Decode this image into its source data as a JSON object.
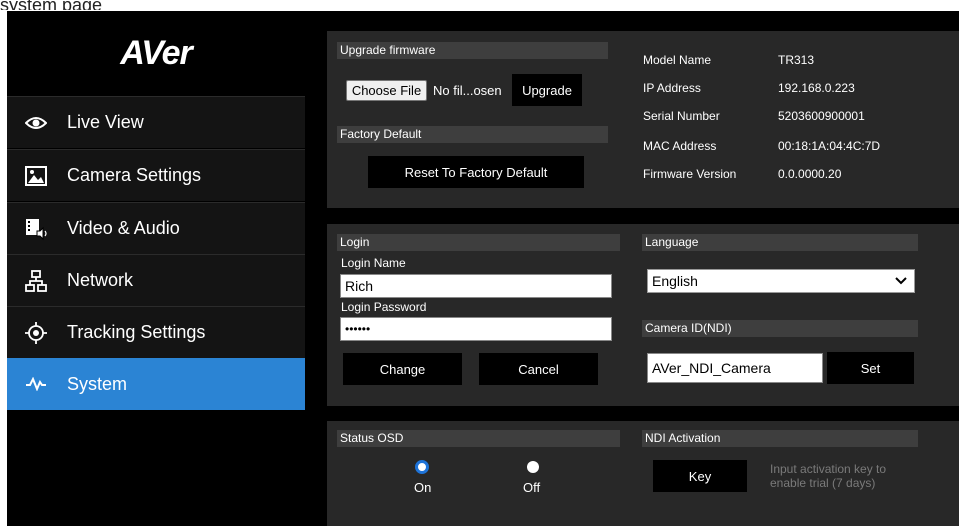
{
  "page_caption": "system page",
  "logo_text": "AVer",
  "sidebar": {
    "items": [
      {
        "label": "Live View",
        "icon": "eye-icon"
      },
      {
        "label": "Camera Settings",
        "icon": "image-icon"
      },
      {
        "label": "Video & Audio",
        "icon": "video-audio-icon"
      },
      {
        "label": "Network",
        "icon": "network-icon"
      },
      {
        "label": "Tracking Settings",
        "icon": "crosshair-icon"
      },
      {
        "label": "System",
        "icon": "pulse-icon",
        "active": true
      }
    ]
  },
  "upgrade": {
    "header": "Upgrade firmware",
    "choose_file_label": "Choose File",
    "file_status": "No fil...osen",
    "upgrade_label": "Upgrade"
  },
  "factory": {
    "header": "Factory Default",
    "reset_label": "Reset To Factory Default"
  },
  "device_info": {
    "model_name_label": "Model Name",
    "model_name": "TR313",
    "ip_label": "IP Address",
    "ip": "192.168.0.223",
    "serial_label": "Serial Number",
    "serial": "5203600900001",
    "mac_label": "MAC Address",
    "mac": "00:18:1A:04:4C:7D",
    "firmware_label": "Firmware Version",
    "firmware": "0.0.0000.20"
  },
  "login": {
    "header": "Login",
    "name_label": "Login Name",
    "name_value": "Rich",
    "password_label": "Login Password",
    "password_value": "••••••",
    "change_label": "Change",
    "cancel_label": "Cancel"
  },
  "language": {
    "header": "Language",
    "selected": "English"
  },
  "camera_id": {
    "header": "Camera ID(NDI)",
    "value": "AVer_NDI_Camera",
    "set_label": "Set"
  },
  "status_osd": {
    "header": "Status OSD",
    "on_label": "On",
    "off_label": "Off",
    "selected": "On"
  },
  "ndi_activation": {
    "header": "NDI Activation",
    "key_label": "Key",
    "hint": "Input activation key to enable trial (7 days)"
  },
  "colors": {
    "active_nav": "#2b84d4",
    "panel": "#282828",
    "section_header": "#3e3e3e",
    "radio_selected": "#1e73d8"
  }
}
